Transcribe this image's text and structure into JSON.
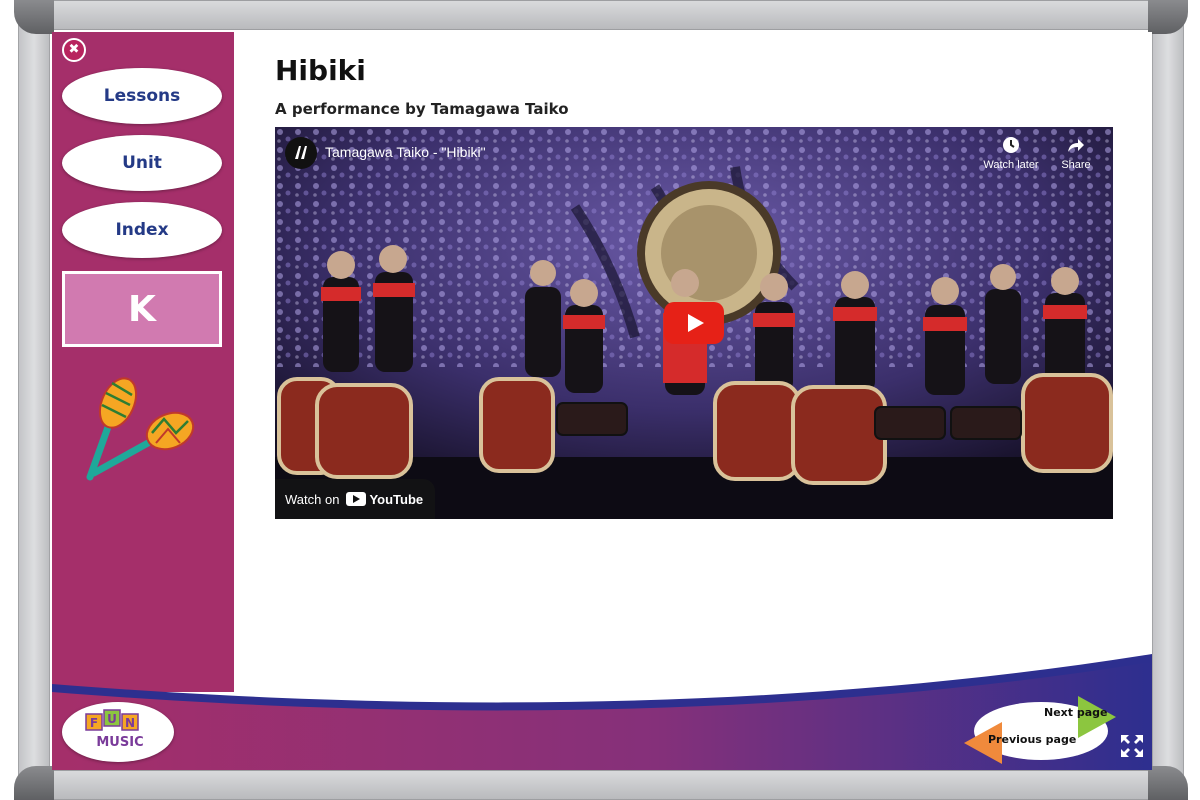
{
  "sidebar": {
    "close_glyph": "✖",
    "items": [
      {
        "label": "Lessons"
      },
      {
        "label": "Unit"
      },
      {
        "label": "Index"
      }
    ],
    "grade": "K"
  },
  "main": {
    "title": "Hibiki",
    "subtitle": "A performance by Tamagawa Taiko"
  },
  "video": {
    "title": "Tamagawa Taiko - \"Hibiki\"",
    "watch_later": "Watch later",
    "share": "Share",
    "watch_on": "Watch on",
    "platform": "YouTube"
  },
  "footer": {
    "logo_text": "FUN MUSIC",
    "next_page": "Next page",
    "previous_page": "Previous page"
  },
  "colors": {
    "sidebar": "#a52f6a",
    "grade_box": "#d17ab0",
    "nav_text": "#243a86",
    "footer_blue": "#2d2f8f",
    "next_arrow": "#8cc63f",
    "prev_arrow": "#f08a3c",
    "youtube_red": "#e62117"
  }
}
